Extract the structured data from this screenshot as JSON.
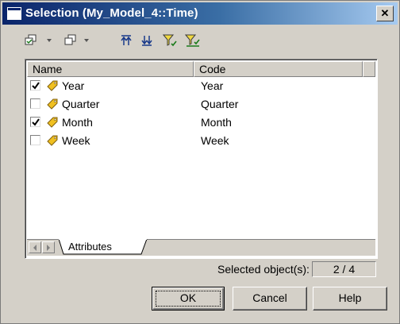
{
  "window": {
    "title": "Selection (My_Model_4::Time)",
    "close_glyph": "✕"
  },
  "toolbar": {
    "buttons": [
      {
        "name": "select-all-icon",
        "has_dropdown": true
      },
      {
        "name": "deselect-all-icon",
        "has_dropdown": true
      },
      {
        "name": "move-up-icon",
        "has_dropdown": false
      },
      {
        "name": "move-down-icon",
        "has_dropdown": false
      },
      {
        "name": "filter-icon",
        "has_dropdown": false
      },
      {
        "name": "filter-checked-icon",
        "has_dropdown": false
      }
    ]
  },
  "columns": {
    "name": "Name",
    "code": "Code"
  },
  "rows": [
    {
      "name": "Year",
      "code": "Year",
      "checked": true
    },
    {
      "name": "Quarter",
      "code": "Quarter",
      "checked": false
    },
    {
      "name": "Month",
      "code": "Month",
      "checked": true
    },
    {
      "name": "Week",
      "code": "Week",
      "checked": false
    }
  ],
  "tab": {
    "label": "Attributes"
  },
  "selection": {
    "label": "Selected object(s):",
    "value": "2 / 4"
  },
  "buttons": {
    "ok": "OK",
    "cancel": "Cancel",
    "help": "Help"
  },
  "colors": {
    "title_start": "#0a246a",
    "title_end": "#a6caf0",
    "face": "#d4d0c8",
    "attr_icon": "#f0c020"
  }
}
